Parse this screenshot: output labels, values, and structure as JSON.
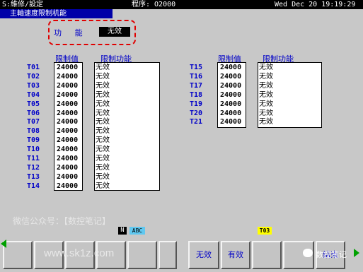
{
  "topbar": {
    "mode": "S:維修/設定",
    "program": "程序: O2000",
    "datetime": "Wed Dec 20 19:19:29"
  },
  "screen_title": "主軸速度限制机能",
  "function": {
    "label": "功 能",
    "value": "无效"
  },
  "headers": {
    "limit_value": "限制值",
    "limit_function": "限制功能"
  },
  "left_tools": [
    {
      "tool": "T01",
      "value": "24000",
      "function": "无效"
    },
    {
      "tool": "T02",
      "value": "24000",
      "function": "无效"
    },
    {
      "tool": "T03",
      "value": "24000",
      "function": "无效"
    },
    {
      "tool": "T04",
      "value": "24000",
      "function": "无效"
    },
    {
      "tool": "T05",
      "value": "24000",
      "function": "无效"
    },
    {
      "tool": "T06",
      "value": "24000",
      "function": "无效"
    },
    {
      "tool": "T07",
      "value": "24000",
      "function": "无效"
    },
    {
      "tool": "T08",
      "value": "24000",
      "function": "无效"
    },
    {
      "tool": "T09",
      "value": "24000",
      "function": "无效"
    },
    {
      "tool": "T10",
      "value": "24000",
      "function": "无效"
    },
    {
      "tool": "T11",
      "value": "24000",
      "function": "无效"
    },
    {
      "tool": "T12",
      "value": "24000",
      "function": "无效"
    },
    {
      "tool": "T13",
      "value": "24000",
      "function": "无效"
    },
    {
      "tool": "T14",
      "value": "24000",
      "function": "无效"
    }
  ],
  "right_tools": [
    {
      "tool": "T15",
      "value": "24000",
      "function": "无效"
    },
    {
      "tool": "T16",
      "value": "24000",
      "function": "无效"
    },
    {
      "tool": "T17",
      "value": "24000",
      "function": "无效"
    },
    {
      "tool": "T18",
      "value": "24000",
      "function": "无效"
    },
    {
      "tool": "T19",
      "value": "24000",
      "function": "无效"
    },
    {
      "tool": "T20",
      "value": "24000",
      "function": "无效"
    },
    {
      "tool": "T21",
      "value": "24000",
      "function": "无效"
    }
  ],
  "watermark": "微信公众号：【数控笔记】",
  "input_mode": {
    "n": "N",
    "abc": "ABC"
  },
  "current_tool": "T03",
  "softkeys": [
    "",
    "",
    "",
    "",
    "",
    "",
    "",
    "无效",
    "有效",
    "",
    "结束"
  ],
  "url_watermark": "www.sk1z.com",
  "brand": "数控笔记",
  "colors": {
    "label_blue": "#0000c8",
    "title_bg": "#0000a8",
    "highlight_red": "#e00000",
    "tool_yellow": "#ffff00"
  }
}
